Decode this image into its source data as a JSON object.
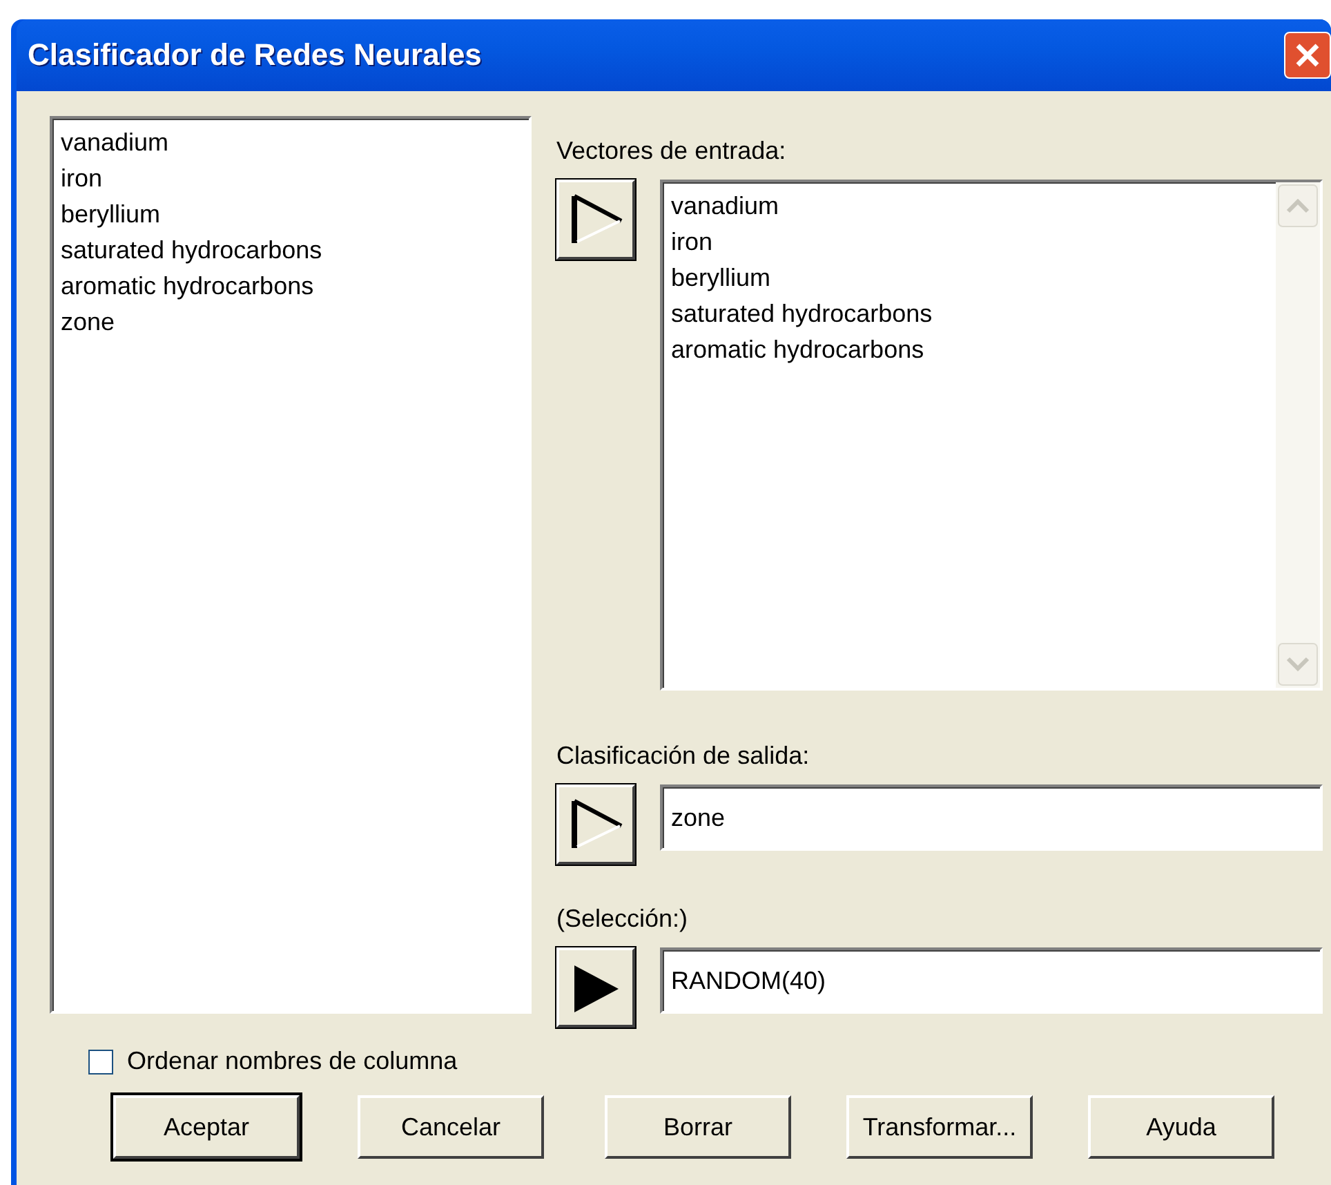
{
  "window": {
    "title": "Clasificador de Redes Neurales"
  },
  "source_list": {
    "items": [
      "vanadium",
      "iron",
      "beryllium",
      "saturated hydrocarbons",
      "aromatic hydrocarbons",
      "zone"
    ]
  },
  "input_vectors": {
    "label": "Vectores de entrada:",
    "arrow": {
      "kind": "hollow"
    },
    "items": [
      "vanadium",
      "iron",
      "beryllium",
      "saturated hydrocarbons",
      "aromatic hydrocarbons"
    ]
  },
  "output": {
    "label": "Clasificación de salida:",
    "arrow": {
      "kind": "hollow"
    },
    "value": "zone"
  },
  "selection": {
    "label": "(Selección:)",
    "arrow": {
      "kind": "filled"
    },
    "value": "RANDOM(40)"
  },
  "sort_checkbox": {
    "label": "Ordenar nombres de columna",
    "checked": false
  },
  "buttons": [
    {
      "label": "Aceptar",
      "default": true
    },
    {
      "label": "Cancelar",
      "default": false
    },
    {
      "label": "Borrar",
      "default": false
    },
    {
      "label": "Transformar...",
      "default": false
    },
    {
      "label": "Ayuda",
      "default": false
    }
  ]
}
